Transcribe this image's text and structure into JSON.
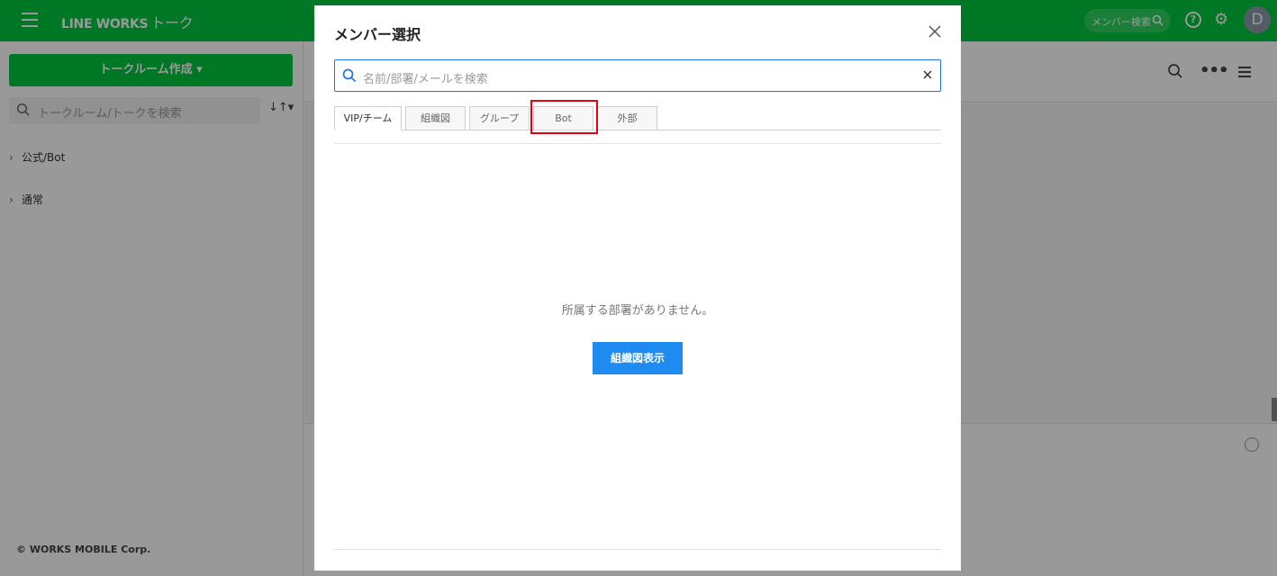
{
  "app": {
    "logo": "LINE WORKS",
    "logo_sub": "トーク",
    "member_search": "メンバー検索",
    "help": "?",
    "avatar_initial": "D"
  },
  "sidebar": {
    "create_button": "トークルーム作成 ▾",
    "search_placeholder": "トークルーム/トークを検索",
    "sort": "↓↑▾",
    "folders": [
      "公式/Bot",
      "通常"
    ],
    "copyright": "© WORKS MOBILE Corp."
  },
  "main": {
    "more": "•••"
  },
  "modal": {
    "title": "メンバー選択",
    "search_placeholder": "名前/部署/メールを検索",
    "tabs": [
      "VIP/チーム",
      "組織図",
      "グループ",
      "Bot",
      "外部"
    ],
    "active_tab": "VIP/チーム",
    "highlighted_tab": "Bot",
    "empty_message": "所属する部署がありません。",
    "org_button": "組織図表示"
  },
  "colors": {
    "brand_green": "#00c73c",
    "accent_blue": "#1f8bf0",
    "highlight_red": "#e60012"
  }
}
